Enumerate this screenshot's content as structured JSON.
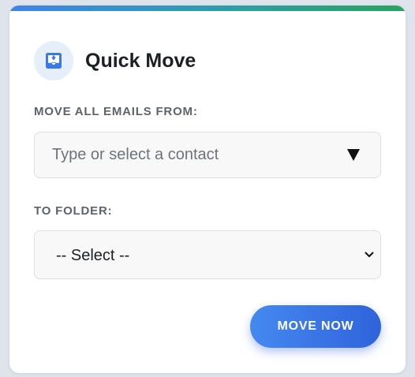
{
  "panel": {
    "title": "Quick Move",
    "icon": "move-to-inbox-icon",
    "accent_gradient": [
      "#3f83e8",
      "#2aa35e"
    ]
  },
  "from_section": {
    "label": "MOVE ALL EMAILS FROM:",
    "contact_input": {
      "value": "",
      "placeholder": "Type or select a contact",
      "dropdown_icon": "triangle-down-icon"
    }
  },
  "to_section": {
    "label": "TO FOLDER:",
    "folder_select": {
      "selected": "-- Select --",
      "dropdown_icon": "chevron-down-icon"
    }
  },
  "actions": {
    "move_now_label": "MOVE NOW",
    "button_color": "#3b74e6"
  }
}
